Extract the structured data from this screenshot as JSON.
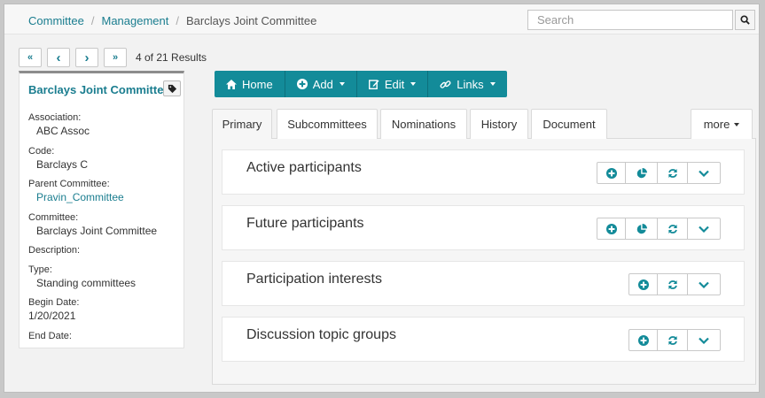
{
  "breadcrumb": {
    "items": [
      "Committee",
      "Management"
    ],
    "current": "Barclays Joint Committee"
  },
  "search": {
    "placeholder": "Search"
  },
  "pager": {
    "first": "«",
    "prev": "‹",
    "next": "›",
    "last": "»",
    "results": "4 of 21 Results"
  },
  "record": {
    "title": "Barclays Joint Committee",
    "fields": {
      "association_label": "Association:",
      "association": "ABC Assoc",
      "code_label": "Code:",
      "code": "Barclays C",
      "parent_label": "Parent Committee:",
      "parent": "Pravin_Committee",
      "committee_label": "Committee:",
      "committee": "Barclays Joint Committee",
      "description_label": "Description:",
      "type_label": "Type:",
      "type": "Standing committees",
      "begin_label": "Begin Date:",
      "begin": "1/20/2021",
      "end_label": "End Date:"
    }
  },
  "toolbar": {
    "home": "Home",
    "add": "Add",
    "edit": "Edit",
    "links": "Links"
  },
  "tabs": [
    "Primary",
    "Subcommittees",
    "Nominations",
    "History",
    "Document"
  ],
  "more": "more",
  "cards": [
    {
      "title": "Active participants"
    },
    {
      "title": "Future participants"
    },
    {
      "title": "Participation interests"
    },
    {
      "title": "Discussion topic groups"
    }
  ],
  "colors": {
    "accent": "#138b99",
    "link": "#1a7d8f"
  },
  "icons": [
    "home-icon",
    "plus-circle-icon",
    "edit-icon",
    "link-icon",
    "search-icon",
    "tag-icon",
    "pie-chart-icon",
    "refresh-icon",
    "chevron-down-icon"
  ]
}
